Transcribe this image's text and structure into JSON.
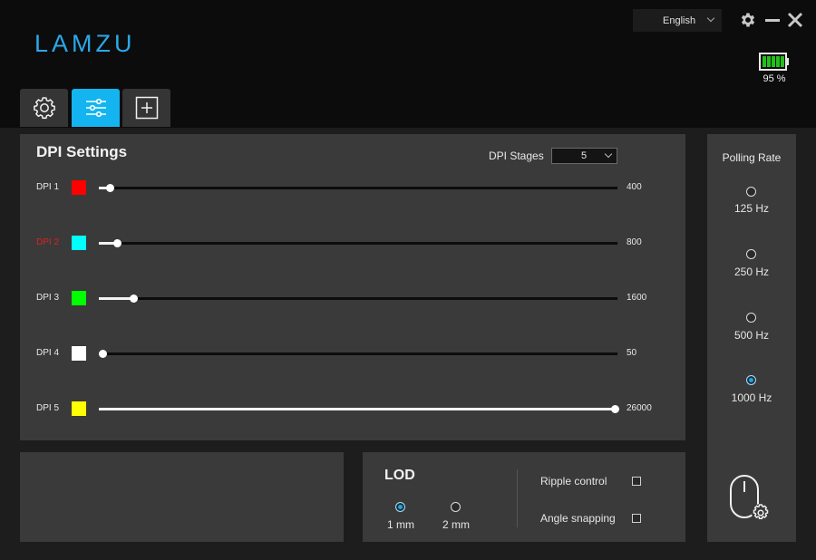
{
  "app": {
    "logo": "LAMZU"
  },
  "header": {
    "language": "English",
    "icons": [
      "gear-icon",
      "minimize-icon",
      "close-icon"
    ],
    "battery": {
      "level": 0.95,
      "label": "95 %",
      "color": "#22c11a"
    }
  },
  "tabs": [
    {
      "name": "settings",
      "icon": "gear-icon",
      "active": false
    },
    {
      "name": "performance",
      "icon": "sliders-icon",
      "active": true
    },
    {
      "name": "macro",
      "icon": "add-box-icon",
      "active": false
    }
  ],
  "dpi": {
    "title": "DPI Settings",
    "stages_label": "DPI Stages",
    "stages_value": "5",
    "max": 26000,
    "items": [
      {
        "label": "DPI 1",
        "value": "400",
        "dpi": 400,
        "color": "#ff0000",
        "selected": false
      },
      {
        "label": "DPI 2",
        "value": "800",
        "dpi": 800,
        "color": "#00ffff",
        "selected": true
      },
      {
        "label": "DPI 3",
        "value": "1600",
        "dpi": 1600,
        "color": "#00ff00",
        "selected": false
      },
      {
        "label": "DPI 4",
        "value": "50",
        "dpi": 50,
        "color": "#ffffff",
        "selected": false
      },
      {
        "label": "DPI 5",
        "value": "26000",
        "dpi": 26000,
        "color": "#ffff00",
        "selected": false
      }
    ]
  },
  "polling": {
    "title": "Polling Rate",
    "options": [
      {
        "label": "125 Hz",
        "selected": false
      },
      {
        "label": "250 Hz",
        "selected": false
      },
      {
        "label": "500 Hz",
        "selected": false
      },
      {
        "label": "1000 Hz",
        "selected": true
      }
    ]
  },
  "lod": {
    "title": "LOD",
    "options": [
      {
        "label": "1 mm",
        "selected": true
      },
      {
        "label": "2 mm",
        "selected": false
      }
    ]
  },
  "options": [
    {
      "label": "Ripple control",
      "checked": false
    },
    {
      "label": "Angle snapping",
      "checked": false
    }
  ],
  "colors": {
    "accent": "#14b4f0",
    "panel": "#3a3a3a"
  }
}
